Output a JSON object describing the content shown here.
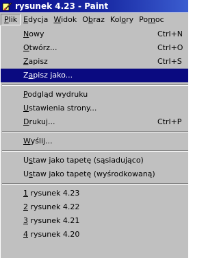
{
  "window": {
    "title": "rysunek 4.23 - Paint",
    "app_icon": "paint-icon"
  },
  "menubar": {
    "items": [
      {
        "label": "Plik"
      },
      {
        "label": "Edycja"
      },
      {
        "label": "Widok"
      },
      {
        "label": "Obraz"
      },
      {
        "label": "Kolory"
      },
      {
        "label": "Pomoc"
      }
    ]
  },
  "menu": {
    "groups": [
      [
        {
          "label": "Nowy",
          "shortcut": "Ctrl+N"
        },
        {
          "label": "Otwórz...",
          "shortcut": "Ctrl+O"
        },
        {
          "label": "Zapisz",
          "shortcut": "Ctrl+S"
        },
        {
          "label": "Zapisz jako...",
          "shortcut": "",
          "selected": true
        }
      ],
      [
        {
          "label": "Podgląd wydruku",
          "shortcut": ""
        },
        {
          "label": "Ustawienia strony...",
          "shortcut": ""
        },
        {
          "label": "Drukuj...",
          "shortcut": "Ctrl+P"
        }
      ],
      [
        {
          "label": "Wyślij...",
          "shortcut": ""
        }
      ],
      [
        {
          "label": "Ustaw jako tapetę (sąsiadująco)",
          "shortcut": ""
        },
        {
          "label": "Ustaw jako tapetę (wyśrodkowaną)",
          "shortcut": ""
        }
      ],
      [
        {
          "label": "1 rysunek 4.23",
          "shortcut": ""
        },
        {
          "label": "2 rysunek 4.22",
          "shortcut": ""
        },
        {
          "label": "3 rysunek 4.21",
          "shortcut": ""
        },
        {
          "label": "4 rysunek 4.20",
          "shortcut": ""
        }
      ]
    ]
  },
  "colors": {
    "titlebar": "#0a0a8c",
    "menu_background": "#c0c0c0",
    "selection": "#0a0a80"
  }
}
